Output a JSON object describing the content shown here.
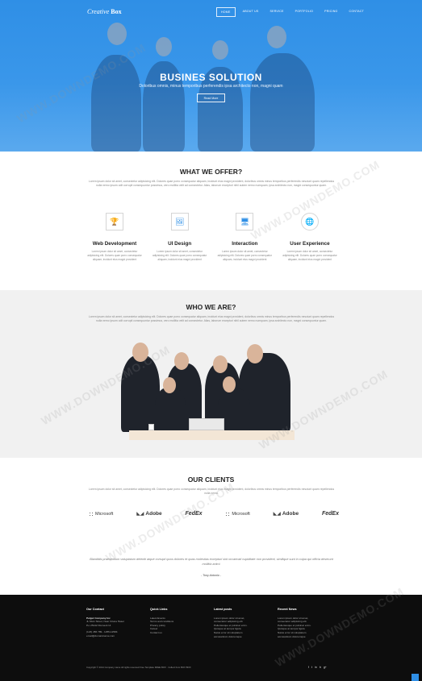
{
  "brand": {
    "script": "Creative",
    "bold": "Box"
  },
  "nav": [
    "HOME",
    "ABOUT US",
    "SERVICE",
    "PORTFOLIO",
    "PRICING",
    "CONTACT"
  ],
  "hero": {
    "title": "BUSINES SOLUTION",
    "subtitle": "Doloribus omnis, minus temporibus perferendis ipsa architecto non, magni quam",
    "button": "Read More"
  },
  "offer": {
    "title": "WHAT WE OFFER?",
    "text": "Lorem ipsum dolor sit amet, consectetur adipisicing elit. Dolores quae porro consequatur aliquam, incidunt eius magni provident, doloribus omnis minus temporibus perferendis nesciunt quam repellendus nulla nemo ipsum odit corrupti consequuntur possimus, vero mollitia velit ad consectetur. Alias, laborum excepturi nihil autem nemo numquam, ipsa architecto non, magni consequuntur quam.",
    "services": [
      {
        "icon": "trophy-icon",
        "glyph": "🏆",
        "shape": "sq",
        "name": "Web Development",
        "desc": "Lorem ipsum dolor sit amet, consectetur adipisicing elit. Dolores quae porro consequatur aliquam, incidunt eius magni provident"
      },
      {
        "icon": "picture-icon",
        "glyph": "🖼",
        "shape": "sq",
        "name": "UI Design",
        "desc": "Lorem ipsum dolor sit amet, consectetur adipisicing elit. Dolores quae porro consequatur aliquam, incidunt eius magni provident"
      },
      {
        "icon": "desktop-icon",
        "glyph": "🖥",
        "shape": "sq",
        "name": "Interaction",
        "desc": "Lorem ipsum dolor sit amet, consectetur adipisicing elit. Dolores quae porro consequatur aliquam, incidunt eius magni provident"
      },
      {
        "icon": "globe-icon",
        "glyph": "🌐",
        "shape": "circ",
        "name": "User Experience",
        "desc": "Lorem ipsum dolor sit amet, consectetur adipisicing elit. Dolores quae porro consequatur aliquam, incidunt eius magni provident"
      }
    ]
  },
  "who": {
    "title": "WHO WE ARE?",
    "text": "Lorem ipsum dolor sit amet, consectetur adipisicing elit. Dolores quae porro consequatur aliquam, incidunt eius magni provident, doloribus omnis minus temporibus perferendis nesciunt quam repellendus nulla nemo ipsum odit corrupti consequuntur possimus, vero mollitia velit ad consectetur. Alias, laborum excepturi nihil autem nemo numquam, ipsa architecto non, magni consequuntur quam."
  },
  "clients": {
    "title": "OUR CLIENTS",
    "text": "Lorem ipsum dolor sit amet, consectetur adipisicing elit. Dolores quae porro consequatur aliquam, incidunt eius magni provident, doloribus omnis minus temporibus perferendis nesciunt quam repellendus nulla nemo.",
    "logos": [
      {
        "kind": "ms",
        "label": "Microsoft"
      },
      {
        "kind": "adobe",
        "label": "Adobe"
      },
      {
        "kind": "fedex",
        "label": "FedEx"
      },
      {
        "kind": "ms",
        "label": "Microsoft"
      },
      {
        "kind": "adobe",
        "label": "Adobe"
      },
      {
        "kind": "fedex",
        "label": "FedEx"
      }
    ]
  },
  "testimonial": {
    "quote": "Blanditiis praesentium voluptatum deleniti atque corrupti quos dolores et quas molestias excepturi sint occaecati cupiditate non provident, similique sunt in culpa qui officia deserunt mollitia animi.",
    "author": "- Tony Antonio -"
  },
  "footer": {
    "contact": {
      "title": "Our Contact",
      "company": "Pelgut Company Inc",
      "lines": [
        "JL Muin Street, Near Ciluna Haser",
        "P.o 25142 Klumeck Ul.",
        "",
        "(123) 456 789 - 1255-12584",
        "email@domainname.com"
      ]
    },
    "quick": {
      "title": "Quick Links",
      "items": [
        "Latest Events",
        "Terms and conditions",
        "Privacy policy",
        "Career",
        "Contact us"
      ]
    },
    "posts": {
      "title": "Latest posts",
      "items": [
        "Lorem ipsum dolor sit amet,",
        "consectetur adipiscing elit.",
        "Pellentesque et pulvinar enim.",
        "Quisque at tempor ligula",
        "Natus error sit voluptatem",
        "accusantium doloremque"
      ]
    },
    "news": {
      "title": "Recent News",
      "items": [
        "Lorem ipsum dolor sit amet,",
        "consectetur adipiscing elit.",
        "Pellentesque et pulvinar enim.",
        "Quisque at tempor ligula",
        "Natus error sit voluptatem",
        "accusantium doloremque"
      ]
    },
    "copyright": "Copyright © 2014 Company name All rights reserved Free Template FREE BOX · Collect from BOX BOX",
    "social": [
      "f",
      "t",
      "in",
      "b",
      "g+"
    ]
  },
  "watermark": "WWW.DOWNDEMO.COM"
}
